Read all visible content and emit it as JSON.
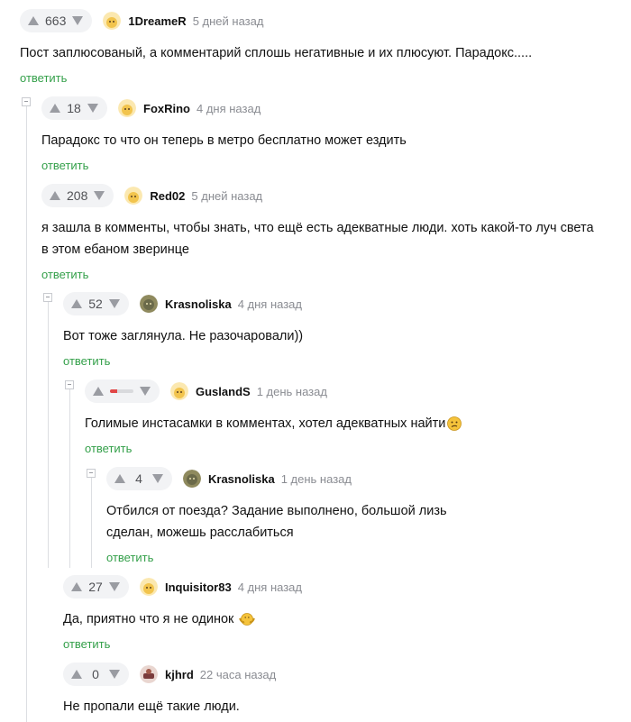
{
  "reply_label": "ответить",
  "comments": [
    {
      "rating": "663",
      "user": "1DreameR",
      "time": "5 дней назад",
      "text": "Пост заплюсованый, а комментарий сплошь негативные и их плюсуют. Парадокс.....",
      "avatar_color": "#f2c44d"
    },
    {
      "rating": "18",
      "user": "FoxRino",
      "time": "4 дня назад",
      "text": "Парадокс то что он теперь в метро бесплатно может ездить",
      "avatar_color": "#f2c44d"
    },
    {
      "rating": "208",
      "user": "Red02",
      "time": "5 дней назад",
      "text": "я зашла в комменты, чтобы знать, что ещё есть адекватные люди. хоть какой-то луч света в этом ебаном зверинце",
      "avatar_color": "#f2c44d"
    },
    {
      "rating": "52",
      "user": "Krasnoliska",
      "time": "4 дня назад",
      "text": "Вот тоже заглянула. Не разочаровали))",
      "avatar_color": "#6b6a4a"
    },
    {
      "rating": "",
      "rating_indicator": {
        "negative_share": 0.3,
        "negative_color": "#e14747"
      },
      "user": "GuslandS",
      "time": "1 день назад",
      "text": "Голимые инстасамки в комментах, хотел адекватных найти",
      "avatar_color": "#f2c44d"
    },
    {
      "rating": "4",
      "user": "Krasnoliska",
      "time": "1 день назад",
      "text": "Отбился от поезда? Задание выполнено, большой лизь сделан, можешь расслабиться",
      "avatar_color": "#6b6a4a"
    },
    {
      "rating": "27",
      "user": "Inquisitor83",
      "time": "4 дня назад",
      "text": "Да, приятно что я не одинок",
      "avatar_color": "#f2c44d"
    },
    {
      "rating": "0",
      "user": "kjhrd",
      "time": "22 часа назад",
      "text": "Не пропали ещё такие люди.",
      "avatar_color": "#7a3b3b"
    }
  ],
  "colors": {
    "reply_link": "#34a04a",
    "rating_bg": "#f2f3f5",
    "thread_line": "#dcdee2"
  }
}
